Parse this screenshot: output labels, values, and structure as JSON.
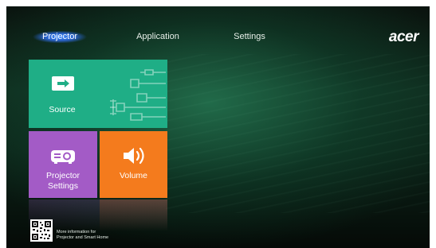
{
  "nav": {
    "tabs": [
      {
        "label": "Projector",
        "active": true
      },
      {
        "label": "Application",
        "active": false
      },
      {
        "label": "Settings",
        "active": false
      }
    ],
    "brand": "acer"
  },
  "tiles": {
    "source": {
      "label": "Source",
      "icon": "source-input-icon",
      "color": "#1fae86"
    },
    "projector_settings": {
      "label_line1": "Projector",
      "label_line2": "Settings",
      "icon": "projector-icon",
      "color": "#a35bc6"
    },
    "volume": {
      "label": "Volume",
      "icon": "speaker-icon",
      "color": "#f47b1d"
    }
  },
  "footer": {
    "info_line1": "More information for",
    "info_line2": "Projector and Smart Home",
    "qr_icon": "qr-code-icon"
  }
}
